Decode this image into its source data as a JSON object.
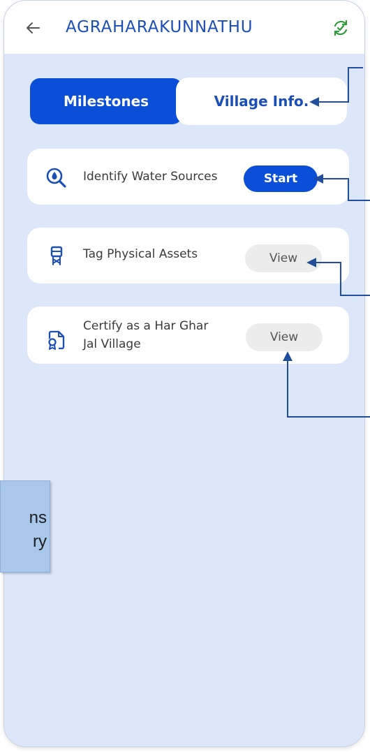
{
  "header": {
    "title": "AGRAHARAKUNNATHU",
    "back_icon": "arrow-left-icon",
    "sync_icon": "sync-check-icon"
  },
  "tabs": {
    "milestones_label": "Milestones",
    "village_info_label": "Village Info."
  },
  "milestones": [
    {
      "icon": "water-search-icon",
      "label": "Identify Water Sources",
      "action": "Start"
    },
    {
      "icon": "water-tower-icon",
      "label": "Tag Physical Assets",
      "action": "View"
    },
    {
      "icon": "certificate-icon",
      "label_line1": "Certify as a Har Ghar",
      "label_line2": "Jal Village",
      "action": "View"
    }
  ],
  "callout": {
    "line1": "ns",
    "line2": "ry"
  },
  "colors": {
    "primary": "#0b4fd9",
    "title": "#1b4fb8",
    "background": "#dde7fb",
    "sync": "#2e9b3a",
    "annotation_arrow": "#1f4e9c",
    "callout_bg": "#a9c7ea"
  }
}
